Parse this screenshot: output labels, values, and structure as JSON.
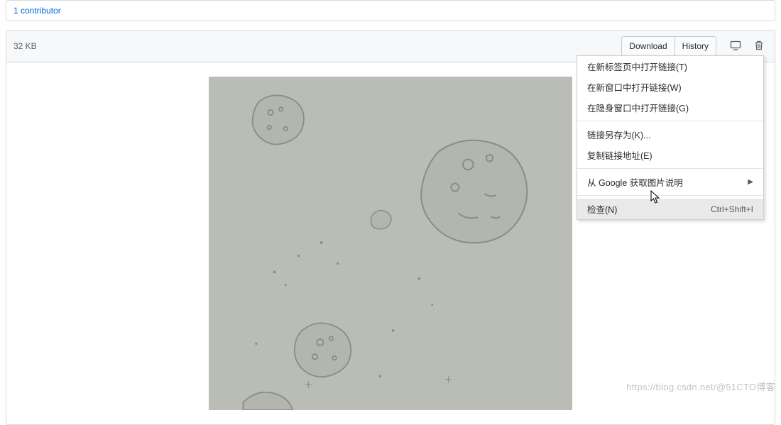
{
  "contributors": {
    "link_text": "1 contributor"
  },
  "file_header": {
    "size": "32 KB",
    "download_label": "Download",
    "history_label": "History",
    "desktop_icon": "desktop-download-icon",
    "trash_icon": "trash-icon"
  },
  "context_menu": {
    "items": [
      {
        "label": "在新标签页中打开链接(T)",
        "shortcut": "",
        "arrow": false
      },
      {
        "label": "在新窗口中打开链接(W)",
        "shortcut": "",
        "arrow": false
      },
      {
        "label": "在隐身窗口中打开链接(G)",
        "shortcut": "",
        "arrow": false
      },
      {
        "sep": true
      },
      {
        "label": "链接另存为(K)...",
        "shortcut": "",
        "arrow": false
      },
      {
        "label": "复制链接地址(E)",
        "shortcut": "",
        "arrow": false
      },
      {
        "sep": true
      },
      {
        "label": "从 Google 获取图片说明",
        "shortcut": "",
        "arrow": true
      },
      {
        "sep": true
      },
      {
        "label": "检查(N)",
        "shortcut": "Ctrl+Shift+I",
        "arrow": false,
        "highlight": true
      }
    ]
  },
  "watermark": "https://blog.csdn.net/@51CTO博客"
}
